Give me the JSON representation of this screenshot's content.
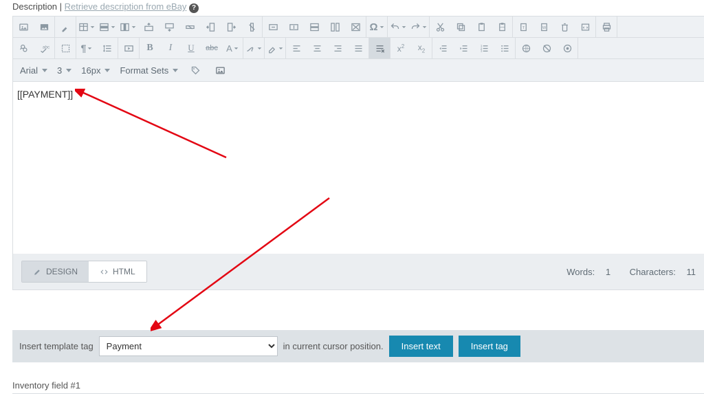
{
  "header": {
    "label": "Description",
    "link_text": "Retrieve description from eBay"
  },
  "toolbar3": {
    "font": "Arial",
    "size_num": "3",
    "size_px": "16px",
    "format_sets": "Format Sets"
  },
  "content": {
    "text": "[[PAYMENT]]"
  },
  "tabs": {
    "design": "DESIGN",
    "html": "HTML"
  },
  "stats": {
    "words_label": "Words:",
    "words": "1",
    "chars_label": "Characters:",
    "chars": "11"
  },
  "insert": {
    "label_before": "Insert template tag",
    "selected": "Payment",
    "label_after": "in current cursor position.",
    "btn_text": "Insert text",
    "btn_tag": "Insert tag"
  },
  "inventory": {
    "label": "Inventory field #1"
  }
}
